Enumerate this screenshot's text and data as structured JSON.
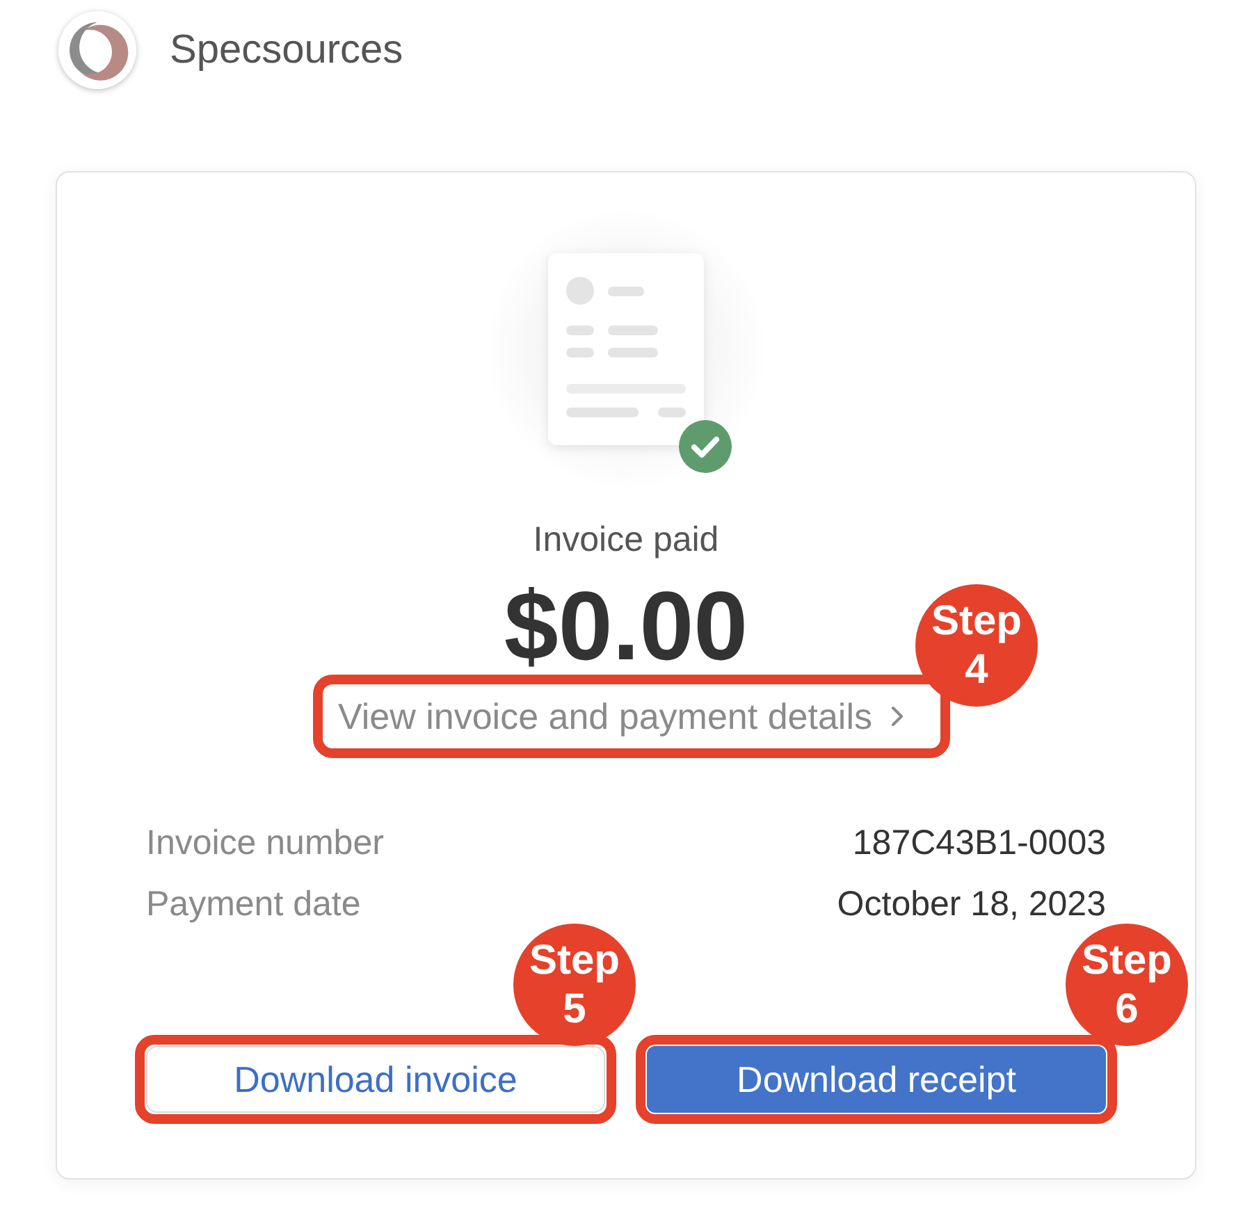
{
  "header": {
    "brand": "Specsources"
  },
  "invoice": {
    "status": "Invoice paid",
    "amount": "$0.00",
    "details_link": {
      "label": "View invoice and payment details",
      "annotation": "Step 4"
    },
    "details": [
      {
        "label": "Invoice number",
        "value": "187C43B1-0003"
      },
      {
        "label": "Payment date",
        "value": "October 18, 2023"
      }
    ],
    "buttons": [
      {
        "label": "Download invoice",
        "kind": "secondary",
        "annotation": "Step 5"
      },
      {
        "label": "Download receipt",
        "kind": "primary",
        "annotation": "Step 6"
      }
    ]
  }
}
